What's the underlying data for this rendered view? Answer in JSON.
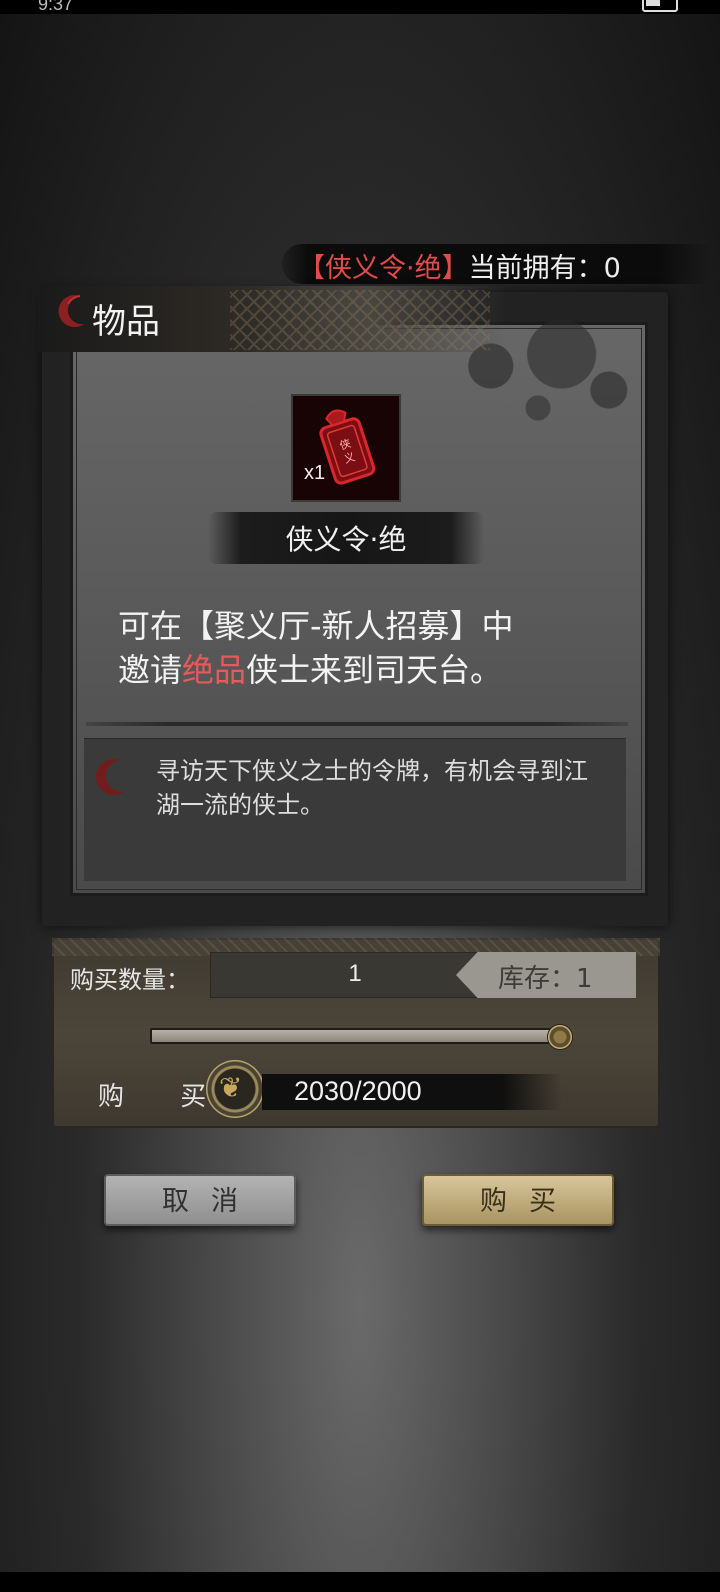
{
  "status_bar": {
    "time": "9:37"
  },
  "ownership": {
    "item_tag": "【侠义令·绝】",
    "owned_label": "当前拥有：",
    "owned_count": "0"
  },
  "panel": {
    "title": "物品",
    "item": {
      "name": "侠义令·绝",
      "count": "x1",
      "icon": "red-token-icon"
    },
    "description": {
      "line1": "可在【聚义厅-新人招募】中",
      "line2_prefix": "邀请",
      "line2_highlight": "绝品",
      "line2_suffix": "侠士来到司天台。"
    },
    "flavor_text": "寻访天下侠义之士的令牌，有机会寻到江湖一流的侠士。"
  },
  "purchase": {
    "quantity_label": "购买数量：",
    "quantity_value": "1",
    "stock_label": "库存：1",
    "slider_fraction": 1.0,
    "buy_label": "购 买",
    "price_text": "2030/2000",
    "currency_icon": "coin-icon"
  },
  "buttons": {
    "cancel": "取消",
    "buy": "购买"
  },
  "colors": {
    "highlight_red": "#e85a5a",
    "buy_gold": "#d8c69a"
  }
}
